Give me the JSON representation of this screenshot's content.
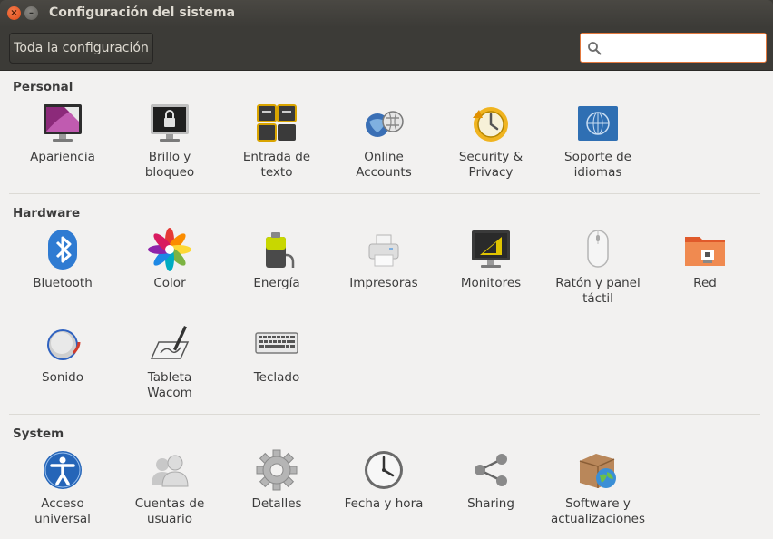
{
  "window": {
    "title": "Configuración del sistema"
  },
  "toolbar": {
    "all_settings_label": "Toda la configuración",
    "search_value": "",
    "search_placeholder": ""
  },
  "sections": {
    "personal": {
      "title": "Personal",
      "items": [
        {
          "label": "Apariencia",
          "icon": "appearance-icon"
        },
        {
          "label": "Brillo y\nbloqueo",
          "icon": "brightness-lock-icon"
        },
        {
          "label": "Entrada de\ntexto",
          "icon": "text-entry-icon"
        },
        {
          "label": "Online\nAccounts",
          "icon": "online-accounts-icon"
        },
        {
          "label": "Security &\nPrivacy",
          "icon": "security-privacy-icon"
        },
        {
          "label": "Soporte de\nidiomas",
          "icon": "language-support-icon"
        }
      ]
    },
    "hardware": {
      "title": "Hardware",
      "items": [
        {
          "label": "Bluetooth",
          "icon": "bluetooth-icon"
        },
        {
          "label": "Color",
          "icon": "color-icon"
        },
        {
          "label": "Energía",
          "icon": "power-icon"
        },
        {
          "label": "Impresoras",
          "icon": "printer-icon"
        },
        {
          "label": "Monitores",
          "icon": "displays-icon"
        },
        {
          "label": "Ratón y panel\ntáctil",
          "icon": "mouse-touchpad-icon"
        },
        {
          "label": "Red",
          "icon": "network-icon"
        },
        {
          "label": "Sonido",
          "icon": "sound-icon"
        },
        {
          "label": "Tableta\nWacom",
          "icon": "wacom-tablet-icon"
        },
        {
          "label": "Teclado",
          "icon": "keyboard-icon"
        }
      ]
    },
    "system": {
      "title": "System",
      "items": [
        {
          "label": "Acceso\nuniversal",
          "icon": "universal-access-icon"
        },
        {
          "label": "Cuentas de\nusuario",
          "icon": "user-accounts-icon"
        },
        {
          "label": "Detalles",
          "icon": "details-icon"
        },
        {
          "label": "Fecha y hora",
          "icon": "clock-icon"
        },
        {
          "label": "Sharing",
          "icon": "sharing-icon"
        },
        {
          "label": "Software y\nactualizaciones",
          "icon": "software-updates-icon"
        }
      ]
    }
  }
}
